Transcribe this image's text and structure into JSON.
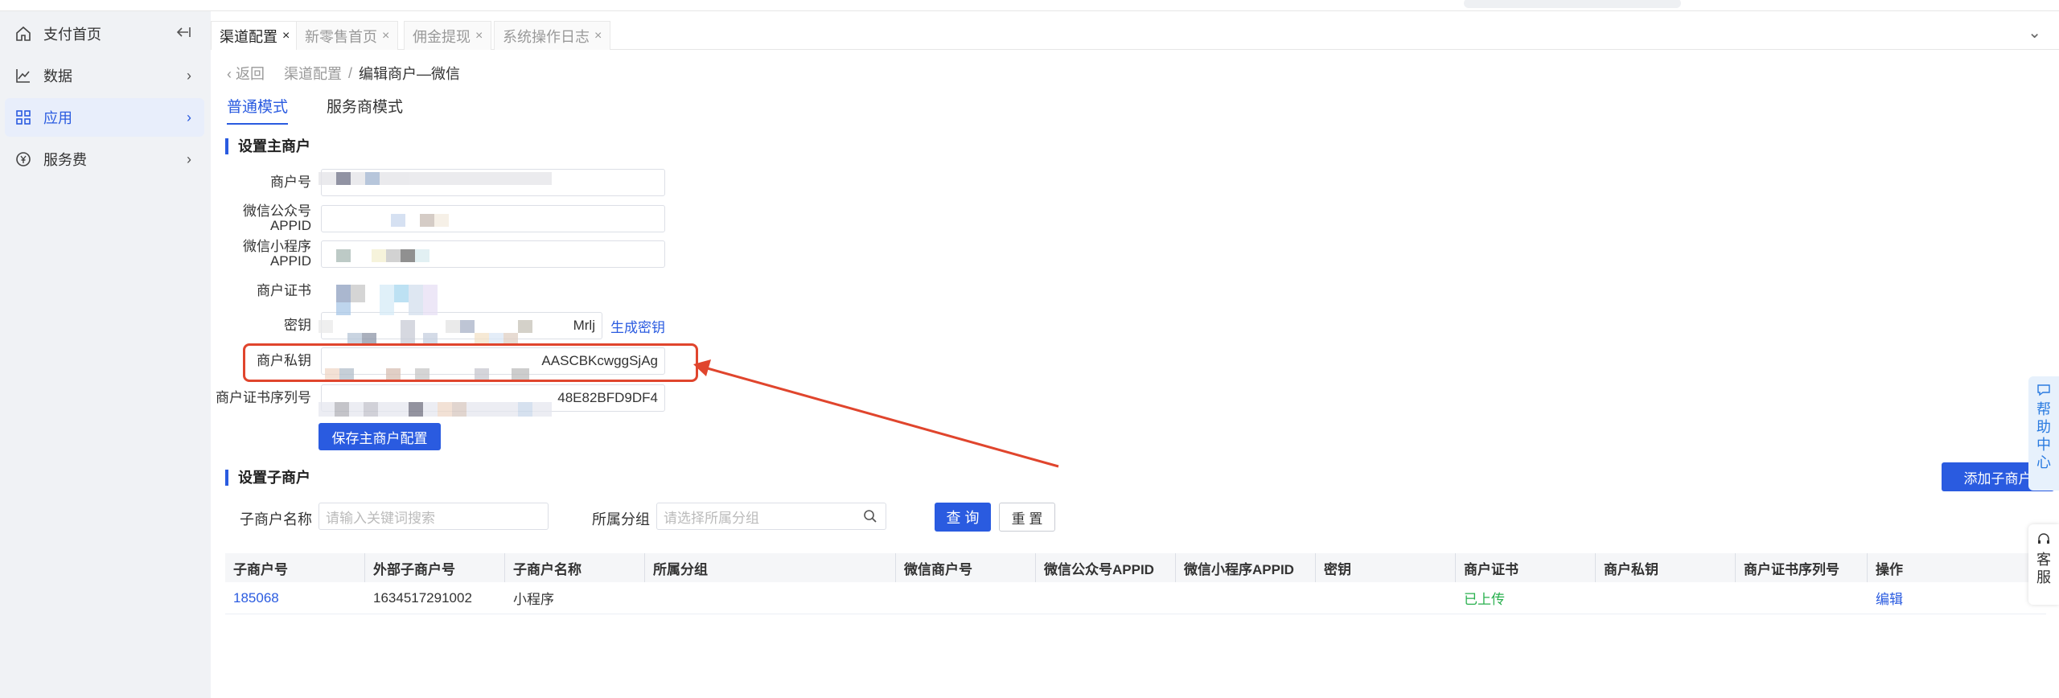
{
  "sidebar": {
    "items": [
      {
        "label": "支付首页",
        "icon": "home-icon",
        "trail": "collapse-icon"
      },
      {
        "label": "数据",
        "icon": "chart-line-icon",
        "trail": "chevron-right-icon"
      },
      {
        "label": "应用",
        "icon": "grid-icon",
        "trail": "chevron-right-icon",
        "active": true
      },
      {
        "label": "服务费",
        "icon": "yen-circle-icon",
        "trail": "chevron-right-icon"
      }
    ]
  },
  "tabs": [
    {
      "label": "渠道配置",
      "active": true
    },
    {
      "label": "新零售首页"
    },
    {
      "label": "佣金提现"
    },
    {
      "label": "系统操作日志"
    }
  ],
  "breadcrumb": {
    "back": "返回",
    "parent": "渠道配置",
    "sep": "/",
    "current": "编辑商户—微信"
  },
  "modes": {
    "normal": "普通模式",
    "provider": "服务商模式"
  },
  "main_merchant": {
    "title": "设置主商户",
    "fields": {
      "merchant_no": {
        "label": "商户号",
        "value": ""
      },
      "mp_appid": {
        "label": "微信公众号APPID",
        "value": ""
      },
      "mini_appid": {
        "label": "微信小程序APPID",
        "value": ""
      },
      "cert": {
        "label": "商户证书",
        "value": ""
      },
      "secret": {
        "label": "密钥",
        "value": "Mrlj"
      },
      "private_key": {
        "label": "商户私钥",
        "value": "AASCBKcwggSjAg"
      },
      "cert_serial": {
        "label": "商户证书序列号",
        "value": "48E82BFD9DF4"
      }
    },
    "generate_key": "生成密钥",
    "save": "保存主商户配置"
  },
  "sub_merchant": {
    "title": "设置子商户",
    "add": "添加子商户",
    "filters": {
      "name_label": "子商户名称",
      "name_placeholder": "请输入关键词搜索",
      "group_label": "所属分组",
      "group_placeholder": "请选择所属分组"
    },
    "query": "查 询",
    "reset": "重 置",
    "columns": [
      "子商户号",
      "外部子商户号",
      "子商户名称",
      "所属分组",
      "微信商户号",
      "微信公众号APPID",
      "微信小程序APPID",
      "密钥",
      "商户证书",
      "商户私钥",
      "商户证书序列号",
      "操作"
    ],
    "rows": [
      [
        "185068",
        "1634517291002",
        "小程序",
        "",
        "",
        "",
        "",
        "",
        "已上传",
        "",
        "",
        "编辑"
      ]
    ]
  },
  "floating": {
    "help": [
      "帮",
      "助",
      "中",
      "心"
    ],
    "service": [
      "客",
      "服"
    ]
  },
  "colors": {
    "accent": "#2a5be0",
    "highlight": "#e0452d",
    "uploaded": "#29b04e"
  }
}
